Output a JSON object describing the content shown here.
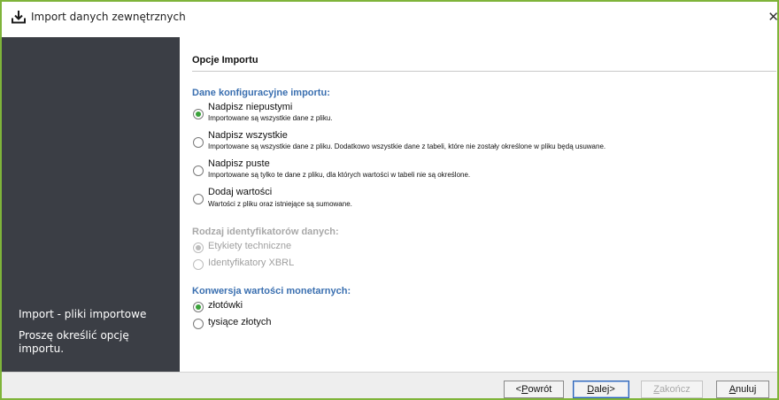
{
  "window": {
    "title": "Import danych zewnętrznych",
    "close_glyph": "✕"
  },
  "sidebar": {
    "heading": "Import - pliki importowe",
    "instruction": "Proszę określić opcję importu."
  },
  "content": {
    "section_title": "Opcje Importu",
    "config_group": {
      "label": "Dane konfiguracyjne importu:",
      "options": [
        {
          "label": "Nadpisz niepustymi",
          "desc": "Importowane są wszystkie dane z pliku.",
          "checked": true
        },
        {
          "label": "Nadpisz wszystkie",
          "desc": "Importowane są wszystkie dane z pliku. Dodatkowo wszystkie dane z tabeli, które nie zostały określone w pliku będą usuwane.",
          "checked": false
        },
        {
          "label": "Nadpisz puste",
          "desc": "Importowane są tylko te dane z pliku, dla których wartości w tabeli nie są określone.",
          "checked": false
        },
        {
          "label": "Dodaj wartości",
          "desc": "Wartości z pliku oraz istniejące są sumowane.",
          "checked": false
        }
      ]
    },
    "identifier_group": {
      "label": "Rodzaj identyfikatorów danych:",
      "options": [
        {
          "label": "Etykiety techniczne",
          "checked": true
        },
        {
          "label": "Identyfikatory XBRL",
          "checked": false
        }
      ]
    },
    "currency_group": {
      "label": "Konwersja wartości monetarnych:",
      "options": [
        {
          "label": "złotówki",
          "checked": true
        },
        {
          "label": "tysiące złotych",
          "checked": false
        }
      ]
    }
  },
  "footer": {
    "back": {
      "mnemonic": "P",
      "rest": "owrót",
      "prefix": "< "
    },
    "next": {
      "mnemonic": "D",
      "rest": "alej",
      "suffix": " >"
    },
    "finish": {
      "mnemonic": "Z",
      "rest": "akończ"
    },
    "cancel": {
      "mnemonic": "A",
      "rest": "nuluj"
    }
  },
  "colors": {
    "accent_border": "#7fb43a",
    "sidebar_bg": "#3b3e45",
    "group_label": "#3a6fb0",
    "radio_checked": "#3aa23a"
  }
}
